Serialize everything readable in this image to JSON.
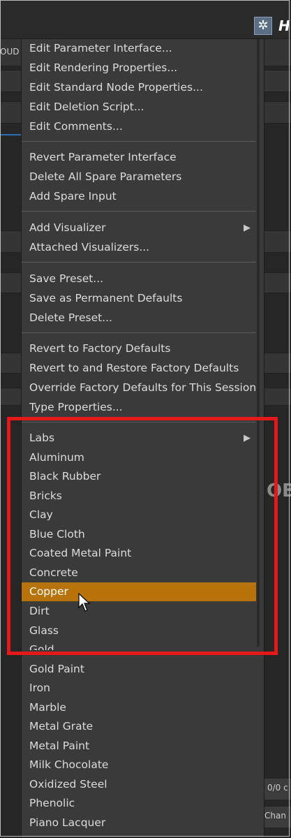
{
  "background": {
    "tab_text": "OUD",
    "header_letter": "H",
    "right_badge": "OB",
    "bottom_right_value": "0/0 c",
    "bottom_right_label": "Chan"
  },
  "menu": {
    "group1": [
      "Edit Parameter Interface...",
      "Edit Rendering Properties...",
      "Edit Standard Node Properties...",
      "Edit Deletion Script...",
      "Edit Comments..."
    ],
    "group2": [
      "Revert Parameter Interface",
      "Delete All Spare Parameters",
      "Add Spare Input"
    ],
    "group3": [
      "Add Visualizer",
      "Attached Visualizers..."
    ],
    "group4": [
      "Save Preset...",
      "Save as Permanent Defaults",
      "Delete Preset..."
    ],
    "group5": [
      "Revert to Factory Defaults",
      "Revert to and Restore Factory Defaults",
      "Override Factory Defaults for This Session",
      "Type Properties..."
    ],
    "presets": [
      "Labs",
      "Aluminum",
      "Black Rubber",
      "Bricks",
      "Clay",
      "Blue Cloth",
      "Coated Metal Paint",
      "Concrete",
      "Copper",
      "Dirt",
      "Glass",
      "Gold",
      "Gold Paint",
      "Iron",
      "Marble",
      "Metal Grate",
      "Metal Paint",
      "Milk Chocolate",
      "Oxidized Steel",
      "Phenolic",
      "Piano Lacquer"
    ],
    "highlighted_item": "Copper",
    "highlight_color": "#b8720a"
  },
  "annotation": {
    "box_color": "#e5191b"
  }
}
